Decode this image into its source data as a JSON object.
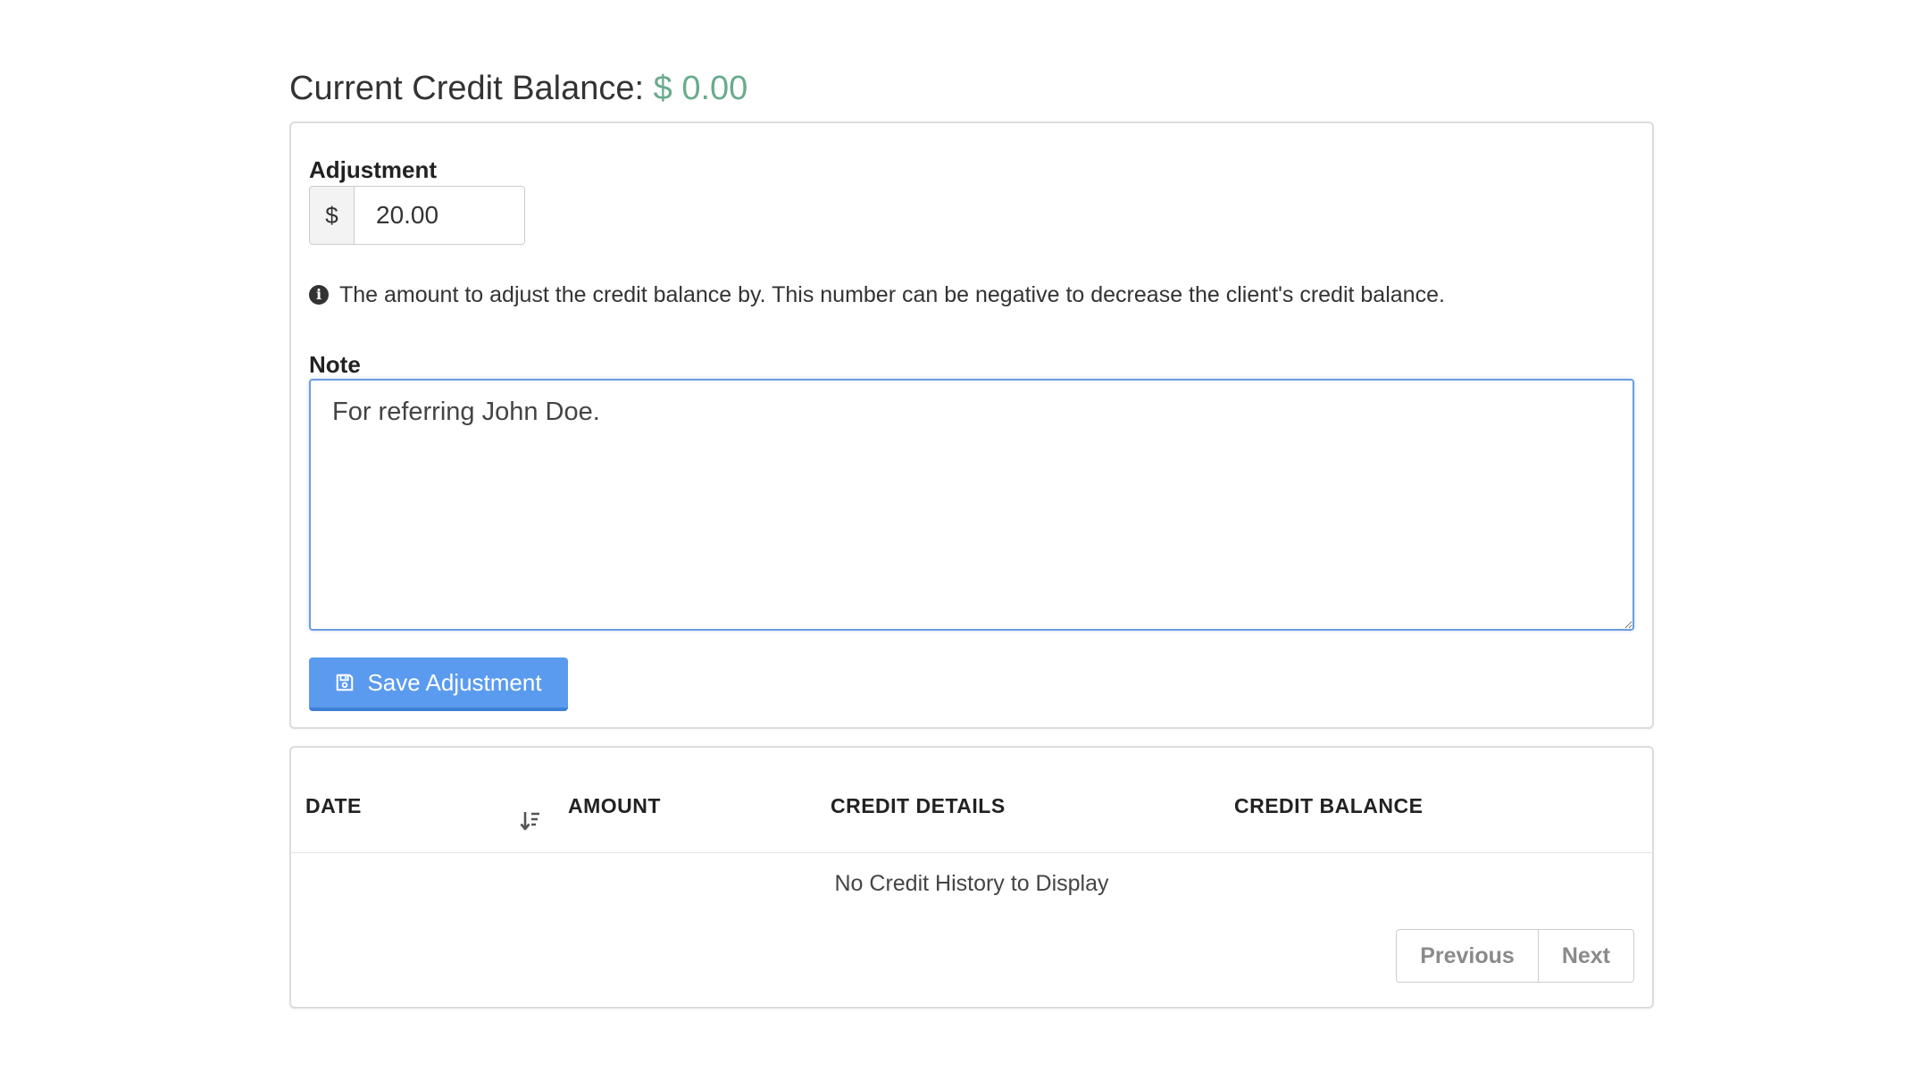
{
  "header": {
    "title_prefix": "Current Credit Balance:",
    "balance": "$ 0.00"
  },
  "form": {
    "adjustment_label": "Adjustment",
    "currency_symbol": "$",
    "adjustment_value": "20.00",
    "help_text": "The amount to adjust the credit balance by. This number can be negative to decrease the client's credit balance.",
    "note_label": "Note",
    "note_value": "For referring John Doe.",
    "save_label": "Save Adjustment"
  },
  "table": {
    "columns": [
      "DATE",
      "AMOUNT",
      "CREDIT DETAILS",
      "CREDIT BALANCE"
    ],
    "empty_message": "No Credit History to Display"
  },
  "pagination": {
    "previous_label": "Previous",
    "next_label": "Next"
  },
  "icons": {
    "info": "info-circle-icon",
    "save": "floppy-disk-icon",
    "sort": "sort-descending-icon"
  },
  "colors": {
    "balance": "#6aab8e",
    "primary": "#5b9bef",
    "focus_border": "#6b9de0"
  }
}
